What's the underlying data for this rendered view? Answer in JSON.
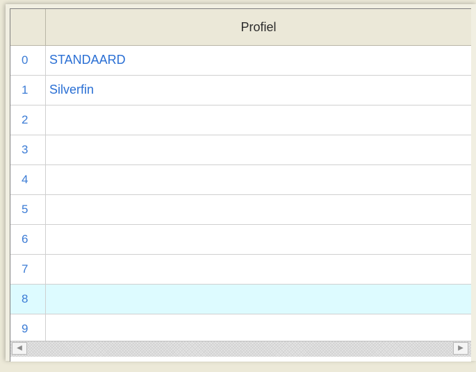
{
  "table": {
    "column_header": "Profiel",
    "rows": [
      {
        "index": "0",
        "value": "STANDAARD",
        "selected": false
      },
      {
        "index": "1",
        "value": "Silverfin",
        "selected": false
      },
      {
        "index": "2",
        "value": "",
        "selected": false
      },
      {
        "index": "3",
        "value": "",
        "selected": false
      },
      {
        "index": "4",
        "value": "",
        "selected": false
      },
      {
        "index": "5",
        "value": "",
        "selected": false
      },
      {
        "index": "6",
        "value": "",
        "selected": false
      },
      {
        "index": "7",
        "value": "",
        "selected": false
      },
      {
        "index": "8",
        "value": "",
        "selected": true
      },
      {
        "index": "9",
        "value": "",
        "selected": false
      }
    ]
  },
  "scrollbar": {
    "left_icon": "scroll-left-arrow-icon",
    "right_icon": "scroll-right-arrow-icon"
  },
  "colors": {
    "row_text": "#2a6fd4",
    "row_number": "#3a7bd5",
    "selected_row_bg": "#ddfbff",
    "header_bg": "#ebe8d8"
  }
}
